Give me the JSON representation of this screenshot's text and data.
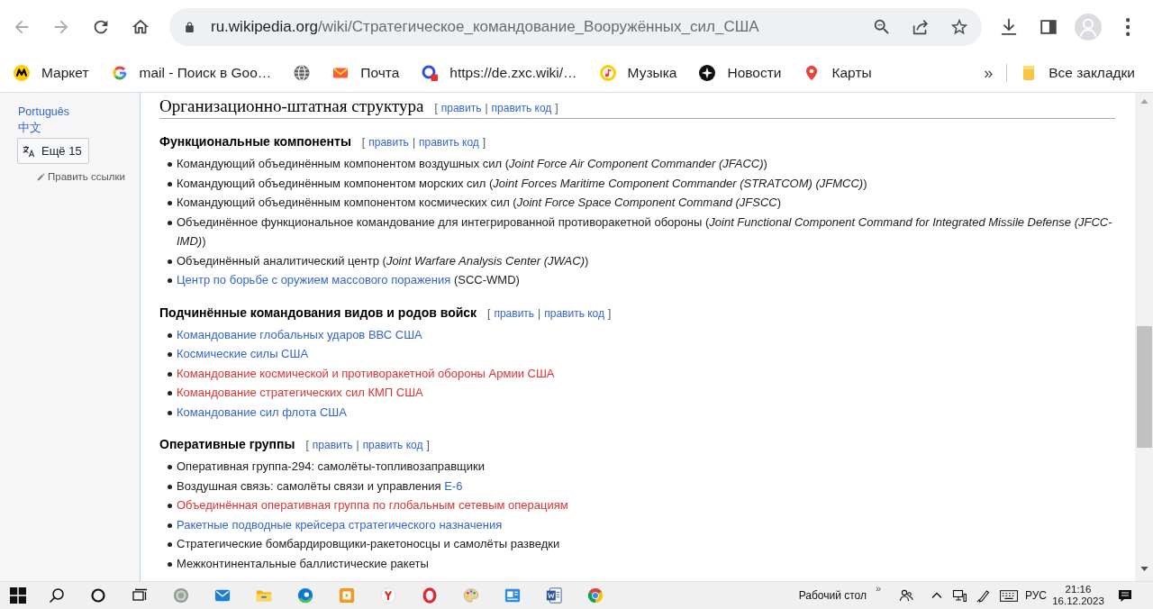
{
  "browser": {
    "back": {
      "disabled": true
    },
    "forward": {
      "disabled": true
    },
    "address": {
      "host": "ru.wikipedia.org",
      "path": "/wiki/Стратегическое_командование_Вооружённых_сил_США"
    }
  },
  "bookmarks": {
    "items": [
      {
        "kind": "link",
        "label": "Маркет"
      },
      {
        "kind": "link",
        "label": "mail - Поиск в Goo…"
      },
      {
        "kind": "icon"
      },
      {
        "kind": "link",
        "label": "Почта"
      },
      {
        "kind": "link",
        "label": "https://de.zxc.wiki/…"
      },
      {
        "kind": "link",
        "label": "Музыка"
      },
      {
        "kind": "link",
        "label": "Новости"
      },
      {
        "kind": "link",
        "label": "Карты"
      }
    ],
    "overflow": "»",
    "all_bookmarks": "Все закладки"
  },
  "sidebar": {
    "languages": [
      "Português",
      "中文"
    ],
    "more_languages": "Ещё 15",
    "edit_links": "Править ссылки"
  },
  "article": {
    "heading": "Организационно-штатная структура",
    "heading_edit": {
      "open": "[",
      "links": [
        "править",
        "править код"
      ],
      "separator": "|",
      "close": "]"
    },
    "sections": [
      {
        "title": "Функциональные компоненты",
        "edit": {
          "open": "[",
          "links": [
            "править",
            "править код"
          ],
          "separator": "|",
          "close": "]"
        },
        "items": [
          {
            "parts": [
              {
                "kind": "text",
                "text": "Командующий объединённым компонентом воздушных сил (*Joint Force Air Component Commander (JFACC)*)"
              }
            ]
          },
          {
            "parts": [
              {
                "kind": "text",
                "text": "Командующий объединённым компонентом морских сил (*Joint Forces Maritime Component Commander (STRATCOM) (JFMCC)*)"
              }
            ]
          },
          {
            "parts": [
              {
                "kind": "text",
                "text": "Командующий объединённым компонентом космических сил (*Joint Force Space Component Command (JFSCC*)"
              }
            ]
          },
          {
            "parts": [
              {
                "kind": "text",
                "text": "Объединённое функциональное командование для интегрированной противоракетной обороны (*Joint Functional Component Command for Integrated Missile Defense (JFCC-IMD)*)"
              }
            ]
          },
          {
            "parts": [
              {
                "kind": "text",
                "text": "Объединённый аналитический центр (*Joint Warfare Analysis Center (JWAC)*)"
              }
            ]
          },
          {
            "parts": [
              {
                "kind": "link",
                "text": "Центр по борьбе с оружием массового поражения"
              },
              {
                "kind": "text",
                "text": " (SCC-WMD)"
              }
            ]
          }
        ]
      },
      {
        "title": "Подчинённые командования видов и родов войск",
        "edit": {
          "open": "[",
          "links": [
            "править",
            "править код"
          ],
          "separator": "|",
          "close": "]"
        },
        "items": [
          {
            "parts": [
              {
                "kind": "link",
                "text": "Командование глобальных ударов ВВС США"
              }
            ]
          },
          {
            "parts": [
              {
                "kind": "link",
                "text": "Космические силы США"
              }
            ]
          },
          {
            "parts": [
              {
                "kind": "redlink",
                "text": "Командование космической и противоракетной обороны Армии США"
              }
            ]
          },
          {
            "parts": [
              {
                "kind": "redlink",
                "text": "Командование стратегических сил КМП США"
              }
            ]
          },
          {
            "parts": [
              {
                "kind": "link",
                "text": "Командование сил флота США"
              }
            ]
          }
        ]
      },
      {
        "title": "Оперативные группы",
        "edit": {
          "open": "[",
          "links": [
            "править",
            "править код"
          ],
          "separator": "|",
          "close": "]"
        },
        "items": [
          {
            "parts": [
              {
                "kind": "text",
                "text": "Оперативная группа-294: самолёты-топливозаправщики"
              }
            ]
          },
          {
            "parts": [
              {
                "kind": "text",
                "text": "Воздушная связь: самолёты связи и управления "
              },
              {
                "kind": "link",
                "text": "E-6"
              }
            ]
          },
          {
            "parts": [
              {
                "kind": "redlink",
                "text": "Объединённая оперативная группа по глобальным сетевым операциям"
              }
            ]
          },
          {
            "parts": [
              {
                "kind": "link",
                "text": "Ракетные подводные крейсера стратегического назначения"
              }
            ]
          },
          {
            "parts": [
              {
                "kind": "text",
                "text": "Стратегические бомбардировщики-ракетоносцы и самолёты разведки"
              }
            ]
          },
          {
            "parts": [
              {
                "kind": "text",
                "text": "Межконтинентальные баллистические ракеты"
              }
            ]
          }
        ]
      }
    ]
  },
  "taskbar": {
    "desktop": "Рабочий стол",
    "overflow": "»",
    "language": "РУС",
    "time": "21:16",
    "date": "16.12.2023"
  }
}
